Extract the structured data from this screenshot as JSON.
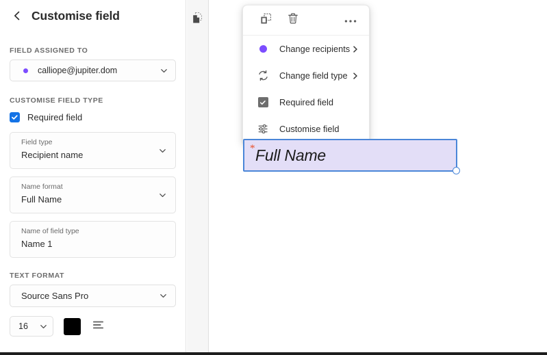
{
  "panel": {
    "title": "Customise field",
    "back_icon": "chevron-left-icon",
    "sections": {
      "assigned_label": "FIELD ASSIGNED TO",
      "assigned_value": "calliope@jupiter.dom",
      "assigned_dot_color": "#7c4dff",
      "customise_label": "CUSTOMISE FIELD TYPE",
      "required_checkbox_label": "Required field",
      "required_checkbox_checked": true,
      "required_checkbox_color": "#1473e6",
      "text_format_label": "TEXT FORMAT"
    },
    "fields": [
      {
        "label": "Field type",
        "value": "Recipient name",
        "has_chevron": true
      },
      {
        "label": "Name format",
        "value": "Full Name",
        "has_chevron": true
      },
      {
        "label": "Name of field type",
        "value": "Name 1",
        "has_chevron": false
      }
    ],
    "text_format": {
      "font_family_value": "Source Sans Pro",
      "font_size_value": "16",
      "color_value": "#000000",
      "align_icon": "text-align-icon"
    }
  },
  "rail": {
    "pages_icon": "pages-duplicate-icon"
  },
  "context_menu": {
    "toolbar": [
      {
        "name": "duplicate-icon",
        "label": "Duplicate"
      },
      {
        "name": "trash-icon",
        "label": "Delete"
      },
      {
        "name": "more-options-icon",
        "label": "More options"
      }
    ],
    "items": [
      {
        "label": "Change recipients",
        "icon": "recipient-dot-icon",
        "has_submenu": true
      },
      {
        "label": "Change field type",
        "icon": "refresh-icon",
        "has_submenu": true
      },
      {
        "label": "Required field",
        "icon": "checkbox-checked-icon",
        "has_submenu": false,
        "checked": true
      },
      {
        "label": "Customise field",
        "icon": "sliders-icon",
        "has_submenu": false
      }
    ]
  },
  "form_field": {
    "placeholder_text": "Full Name",
    "required_marker": "*",
    "required_marker_color": "#e8502a",
    "fill_color": "#e3def7",
    "border_color": "#4a86d8",
    "resize_handle": "resize-handle"
  }
}
